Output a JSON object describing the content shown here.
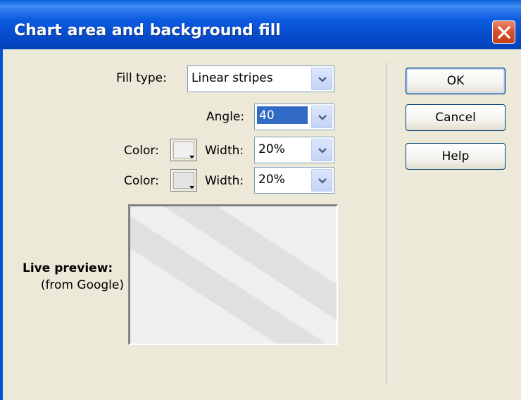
{
  "window": {
    "title": "Chart area and background fill"
  },
  "form": {
    "fill_type_label": "Fill type:",
    "fill_type_value": "Linear stripes",
    "angle_label": "Angle:",
    "angle_value": "40",
    "color1_label": "Color:",
    "color1_swatch": "#F0F0F0",
    "width1_label": "Width:",
    "width1_value": "20%",
    "color2_label": "Color:",
    "color2_swatch": "#E4E4E4",
    "width2_label": "Width:",
    "width2_value": "20%"
  },
  "preview": {
    "label_bold": "Live preview:",
    "label_sub": "(from Google)",
    "background": "#EFEFEF",
    "stripe_color": "#E0E0E0"
  },
  "buttons": {
    "ok": "OK",
    "cancel": "Cancel",
    "help": "Help"
  },
  "colors": {
    "titlebar": "#0548C7",
    "dialog_bg": "#ECE9D8",
    "selection": "#316AC5"
  },
  "icons": {
    "close": "close-x-icon",
    "dropdown": "chevron-down-icon"
  }
}
